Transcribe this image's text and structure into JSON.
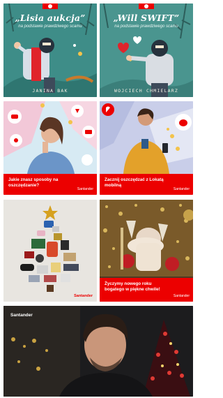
{
  "tiles": [
    {
      "title": "„Lisia aukcja”",
      "subtitle": "na podstawie prawdziwego scamu",
      "author": "JANINA BAK"
    },
    {
      "title": "„Will SWIFT”",
      "subtitle": "na podstawie prawdziwego scamu",
      "author": "WOJCIECH CHMIELARZ"
    },
    {
      "caption": "Jakie znasz sposoby na oszczędzanie?",
      "brand": "Santander"
    },
    {
      "caption": "Zacznij oszczędzać z Lokatą mobilną",
      "brand": "Santander"
    },
    {
      "brand": "Santander"
    },
    {
      "caption": "Życzymy nowego roku bogatego w piękne chwile!",
      "brand": "Santander"
    },
    {
      "brand": "Santander"
    }
  ],
  "colors": {
    "brand_red": "#ec0000",
    "teal": "#3f8e8a"
  }
}
